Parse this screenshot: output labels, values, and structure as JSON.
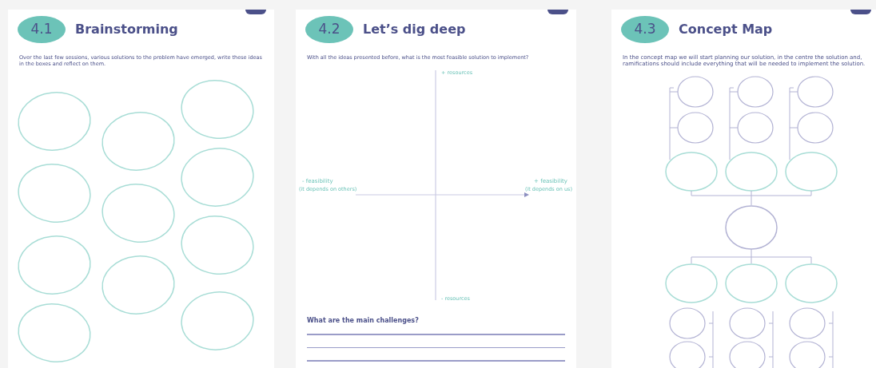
{
  "pages": [
    {
      "kind": "brainstorm",
      "number": "4.1",
      "title": "Brainstorming",
      "intro": "Over the last few sessions, various solutions to the problem have emerged, write these ideas in the boxes and reflect on them."
    },
    {
      "kind": "matrix",
      "number": "4.2",
      "title": "Let’s dig deep",
      "intro": "With all the ideas presented before, what is the most feasible solution to implement?",
      "axis": {
        "top": "+ resources",
        "bottom": "- resources",
        "left": "- feasibility",
        "left_note": "(it depends on others)",
        "right": "+ feasibility",
        "right_note": "(it depends on us)"
      },
      "question": "What are the main challenges?"
    },
    {
      "kind": "concept",
      "number": "4.3",
      "title": "Concept Map",
      "intro": "In the concept map we will start planning our solution, in the centre the solution and,",
      "intro_2": "ramifications should include everything that will be needed to implement the solution."
    }
  ]
}
